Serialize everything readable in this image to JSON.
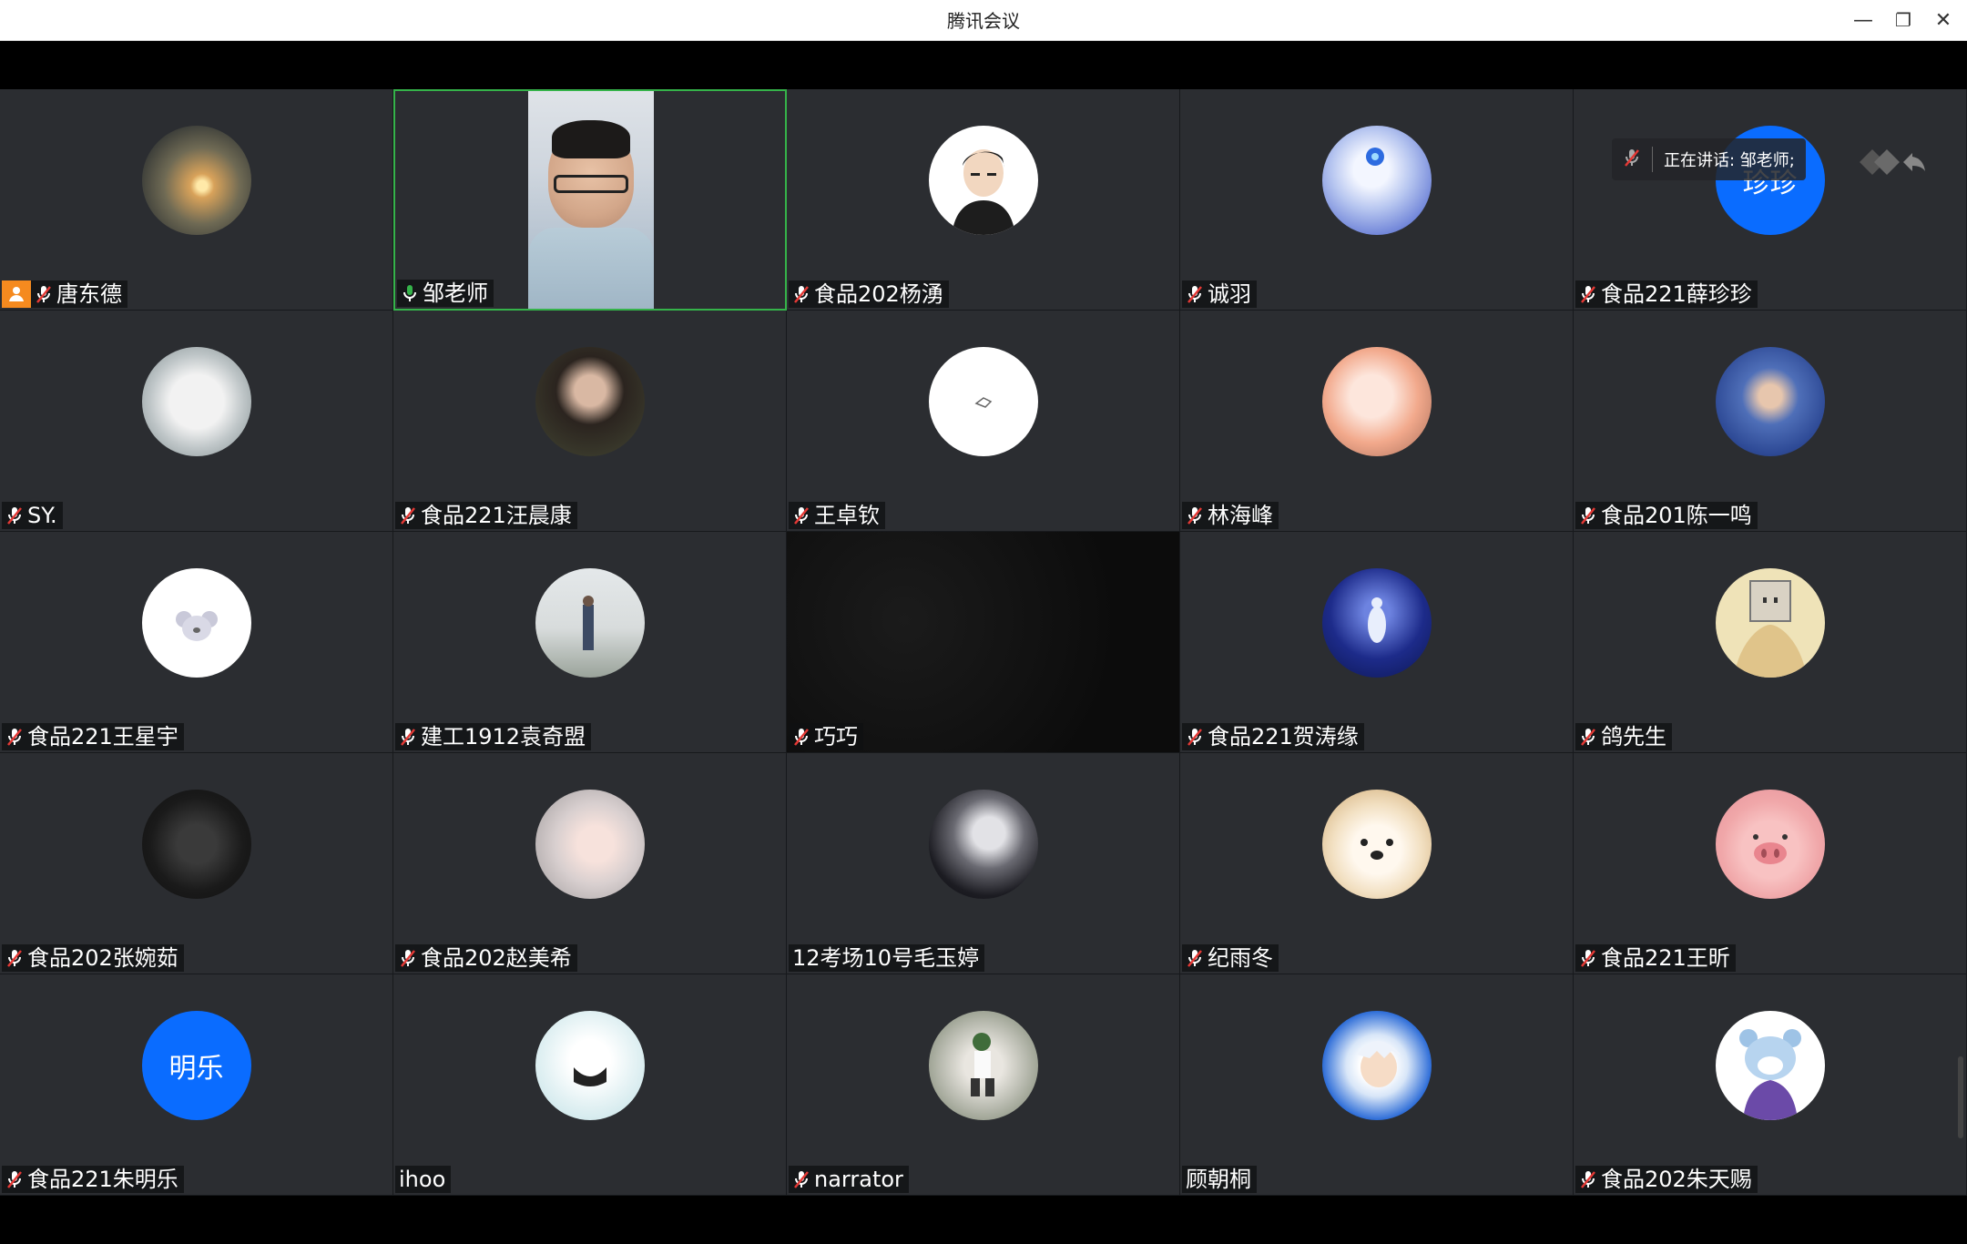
{
  "window": {
    "title": "腾讯会议",
    "controls": [
      "minimize-icon",
      "restore-icon",
      "close-icon"
    ]
  },
  "speaking_indicator": {
    "text": "正在讲话: 邹老师;"
  },
  "colors": {
    "accent_blue": "#0a6cff",
    "active_green": "#35b34a",
    "host_orange": "#f58a1f",
    "tile_bg": "#2b2d31"
  },
  "participants": [
    {
      "name": "唐东德",
      "avatar": "sunset-avatar",
      "muted": true,
      "host": true
    },
    {
      "name": "邹老师",
      "avatar": "video-feed",
      "muted": false,
      "active": true
    },
    {
      "name": "食品202杨湧",
      "avatar": "cartoon-man-avatar",
      "muted": true
    },
    {
      "name": "诚羽",
      "avatar": "anime-headphones-avatar",
      "muted": true
    },
    {
      "name": "食品221薛珍珍",
      "avatar": "text-avatar",
      "avatar_text": "珍珍",
      "muted": true
    },
    {
      "name": "SY.",
      "avatar": "white-cat-avatar",
      "muted": true
    },
    {
      "name": "食品221汪晨康",
      "avatar": "boy-portrait-avatar",
      "muted": true
    },
    {
      "name": "王卓钦",
      "avatar": "white-sketch-avatar",
      "muted": true
    },
    {
      "name": "林海峰",
      "avatar": "anime-girls-avatar",
      "muted": true
    },
    {
      "name": "食品201陈一鸣",
      "avatar": "sports-player-avatar",
      "muted": true
    },
    {
      "name": "食品221王星宇",
      "avatar": "koala-avatar",
      "muted": true
    },
    {
      "name": "建工1912袁奇盟",
      "avatar": "person-outdoor-avatar",
      "muted": true
    },
    {
      "name": "巧巧",
      "avatar": "black-video",
      "muted": true
    },
    {
      "name": "食品221贺涛缘",
      "avatar": "night-scene-avatar",
      "muted": true
    },
    {
      "name": "鸽先生",
      "avatar": "box-head-avatar",
      "muted": true
    },
    {
      "name": "食品202张婉茹",
      "avatar": "couple-dark-avatar",
      "muted": true
    },
    {
      "name": "食品202赵美希",
      "avatar": "girl-portrait-avatar",
      "muted": true
    },
    {
      "name": "12考场10号毛玉婷",
      "avatar": "white-hair-anime-avatar",
      "muted": false,
      "no_mic": true
    },
    {
      "name": "纪雨冬",
      "avatar": "dog-avatar",
      "muted": true
    },
    {
      "name": "食品221王昕",
      "avatar": "pig-avatar",
      "muted": true
    },
    {
      "name": "食品221朱明乐",
      "avatar": "text-avatar",
      "avatar_text": "明乐",
      "muted": true
    },
    {
      "name": "ihoo",
      "avatar": "masked-boy-avatar",
      "muted": false,
      "no_mic": true
    },
    {
      "name": "narrator",
      "avatar": "child-outdoor-avatar",
      "muted": true
    },
    {
      "name": "顾朝桐",
      "avatar": "gintoki-avatar",
      "muted": false,
      "no_mic": true
    },
    {
      "name": "食品202朱天赐",
      "avatar": "bear-cartoon-avatar",
      "muted": true
    }
  ]
}
